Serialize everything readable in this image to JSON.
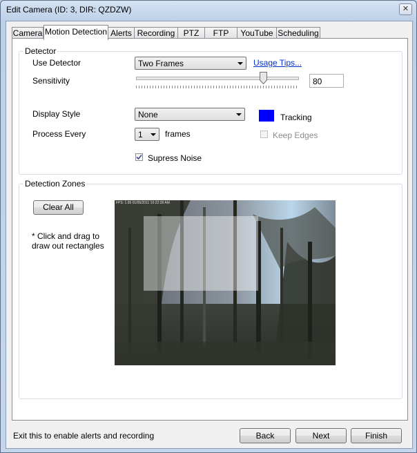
{
  "window": {
    "title": "Edit Camera (ID: 3, DIR: QZDZW)",
    "close_glyph": "✕"
  },
  "tabs": [
    {
      "label": "Camera"
    },
    {
      "label": "Motion Detection"
    },
    {
      "label": "Alerts"
    },
    {
      "label": "Recording"
    },
    {
      "label": "PTZ"
    },
    {
      "label": "FTP"
    },
    {
      "label": "YouTube"
    },
    {
      "label": "Scheduling"
    }
  ],
  "active_tab": "Motion Detection",
  "detector": {
    "legend": "Detector",
    "use_detector_label": "Use Detector",
    "use_detector_value": "Two Frames",
    "usage_tips": "Usage Tips...",
    "sensitivity_label": "Sensitivity",
    "sensitivity_value": "80",
    "display_style_label": "Display Style",
    "display_style_value": "None",
    "tracking_color": "#0000ff",
    "tracking_label": "Tracking",
    "process_every_label": "Process Every",
    "process_every_value": "1",
    "frames_label": "frames",
    "keep_edges_label": "Keep Edges",
    "keep_edges_checked": false,
    "supress_noise_label": "Supress Noise",
    "supress_noise_checked": true
  },
  "zones": {
    "legend": "Detection Zones",
    "clear_all_label": "Clear All",
    "hint": "* Click and drag to draw out rectangles",
    "overlay_text": "FPS: 1.95 01/05/2011 10:22:28 AM"
  },
  "footer": {
    "status": "Exit this to enable alerts and recording",
    "back_label": "Back",
    "next_label": "Next",
    "finish_label": "Finish"
  },
  "colors": {
    "accent": "#0000ff",
    "link": "#0033cc"
  }
}
